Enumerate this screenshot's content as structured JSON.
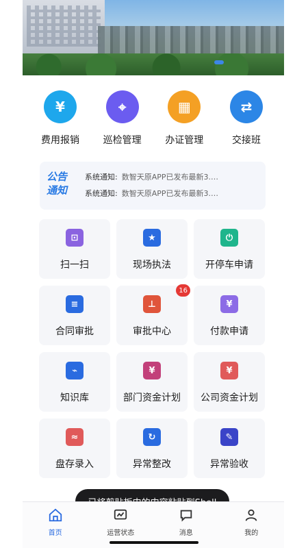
{
  "banner": {
    "indicator_count": 1
  },
  "quick_actions": [
    {
      "label": "费用报销",
      "icon": "yen-receipt-icon",
      "color": "#1ea7ec",
      "glyph": "¥"
    },
    {
      "label": "巡检管理",
      "icon": "map-pin-icon",
      "color": "#6b5cf0",
      "glyph": "⌖"
    },
    {
      "label": "办证管理",
      "icon": "id-card-icon",
      "color": "#f4a024",
      "glyph": "▦"
    },
    {
      "label": "交接班",
      "icon": "user-switch-icon",
      "color": "#2c86e6",
      "glyph": "⇄"
    }
  ],
  "notice": {
    "logo_line1": "公告",
    "logo_line2": "通知",
    "items": [
      {
        "tag": "系统通知:",
        "message": "数智天原APP已发布最新3.…"
      },
      {
        "tag": "系统通知:",
        "message": "数智天原APP已发布最新3.…"
      }
    ]
  },
  "grid": [
    {
      "label": "扫一扫",
      "icon": "scan-icon",
      "color": "#8a63e0",
      "glyph": "⊡"
    },
    {
      "label": "现场执法",
      "icon": "police-badge-icon",
      "color": "#2a6be0",
      "glyph": "★"
    },
    {
      "label": "开停车申请",
      "icon": "power-icon",
      "color": "#1fb58c",
      "glyph": "⏻"
    },
    {
      "label": "合同审批",
      "icon": "contract-icon",
      "color": "#2a6be0",
      "glyph": "≡"
    },
    {
      "label": "审批中心",
      "icon": "stamp-icon",
      "color": "#e0553b",
      "glyph": "⊥",
      "badge": "16"
    },
    {
      "label": "付款申请",
      "icon": "payment-icon",
      "color": "#8c6be6",
      "glyph": "¥"
    },
    {
      "label": "知识库",
      "icon": "knowledge-icon",
      "color": "#2a6be0",
      "glyph": "⌁"
    },
    {
      "label": "部门资金计划",
      "icon": "dept-fund-icon",
      "color": "#c2407a",
      "glyph": "¥"
    },
    {
      "label": "公司资金计划",
      "icon": "company-fund-icon",
      "color": "#e05a5a",
      "glyph": "¥"
    },
    {
      "label": "盘存录入",
      "icon": "inventory-icon",
      "color": "#e05a5a",
      "glyph": "≈"
    },
    {
      "label": "异常整改",
      "icon": "rectify-icon",
      "color": "#2a6be0",
      "glyph": "↻"
    },
    {
      "label": "异常验收",
      "icon": "acceptance-icon",
      "color": "#3a44c8",
      "glyph": "✎"
    }
  ],
  "bottom_nav": [
    {
      "label": "首页",
      "icon": "home-icon",
      "active": true
    },
    {
      "label": "运营状态",
      "icon": "operations-icon",
      "active": false
    },
    {
      "label": "消息",
      "icon": "message-icon",
      "active": false
    },
    {
      "label": "我的",
      "icon": "profile-icon",
      "active": false
    }
  ],
  "toast": {
    "text": "已将剪贴板中的内容粘贴到Shell"
  }
}
